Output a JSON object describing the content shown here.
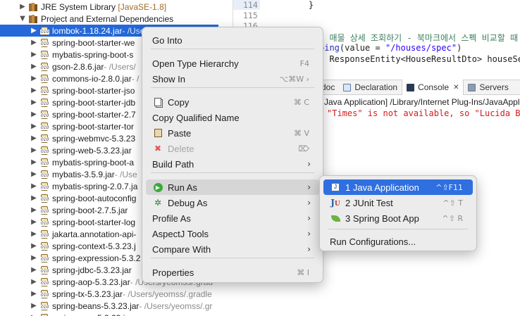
{
  "explorer": {
    "rows": [
      {
        "label": "JRE System Library",
        "path": "",
        "tag": "[JavaSE-1.8]"
      },
      {
        "label": "Project and External Dependencies",
        "path": "",
        "tag": ""
      },
      {
        "label": "lombok-1.18.24.jar",
        "path": " - /Users/yeomss/.gradle",
        "tag": ""
      },
      {
        "label": "spring-boot-starter-we",
        "path": "",
        "tag": ""
      },
      {
        "label": "mybatis-spring-boot-s",
        "path": "",
        "tag": ""
      },
      {
        "label": "gson-2.8.6.jar",
        "path": " - /Users/",
        "tag": ""
      },
      {
        "label": "commons-io-2.8.0.jar",
        "path": " - /",
        "tag": ""
      },
      {
        "label": "spring-boot-starter-jso",
        "path": "",
        "tag": ""
      },
      {
        "label": "spring-boot-starter-jdb",
        "path": "",
        "tag": ""
      },
      {
        "label": "spring-boot-starter-2.7",
        "path": "",
        "tag": ""
      },
      {
        "label": "spring-boot-starter-tor",
        "path": "",
        "tag": ""
      },
      {
        "label": "spring-webmvc-5.3.23",
        "path": "",
        "tag": ""
      },
      {
        "label": "spring-web-5.3.23.jar",
        "path": "",
        "tag": ""
      },
      {
        "label": "mybatis-spring-boot-a",
        "path": "",
        "tag": ""
      },
      {
        "label": "mybatis-3.5.9.jar",
        "path": " - /Use",
        "tag": ""
      },
      {
        "label": "mybatis-spring-2.0.7.ja",
        "path": "",
        "tag": ""
      },
      {
        "label": "spring-boot-autoconfig",
        "path": "",
        "tag": ""
      },
      {
        "label": "spring-boot-2.7.5.jar",
        "path": "",
        "tag": ""
      },
      {
        "label": "spring-boot-starter-log",
        "path": "",
        "tag": ""
      },
      {
        "label": "jakarta.annotation-api-",
        "path": "",
        "tag": ""
      },
      {
        "label": "spring-context-5.3.23.j",
        "path": "",
        "tag": ""
      },
      {
        "label": "spring-expression-5.3.2",
        "path": "",
        "tag": ""
      },
      {
        "label": "spring-jdbc-5.3.23.jar",
        "path": "",
        "tag": ""
      },
      {
        "label": "spring-aop-5.3.23.jar",
        "path": " - /Users/yeomss/.grad",
        "tag": ""
      },
      {
        "label": "spring-tx-5.3.23.jar",
        "path": " - /Users/yeomss/.gradle",
        "tag": ""
      },
      {
        "label": "spring-beans-5.3.23.jar",
        "path": " - /Users/yeomss/.gr",
        "tag": ""
      },
      {
        "label": "spring-core-5.3.23.jar",
        "path": "",
        "tag": ""
      }
    ]
  },
  "editor": {
    "line_numbers": [
      "114",
      "115",
      "116"
    ],
    "lines": [
      {
        "text": "    }",
        "cls": ""
      },
      {
        "text": "",
        "cls": ""
      },
      {
        "text": "",
        "cls": ""
      },
      {
        "text": "/ 매물 상세 조회하기 - 북마크에서 스펙 비교할 때 쓰",
        "cls": "cmt"
      },
      {
        "text": "ping(value = \"/houses/spec\")",
        "cls": ""
      },
      {
        "text": "  ResponseEntity<HouseResultDto> houseSe",
        "cls": ""
      }
    ]
  },
  "console_view": {
    "tabs": [
      {
        "label": "doc",
        "icon": "javadoc-icon",
        "active": false,
        "closable": false
      },
      {
        "label": "Declaration",
        "icon": "declaration-icon",
        "active": false,
        "closable": false
      },
      {
        "label": "Console",
        "icon": "console-icon",
        "active": true,
        "closable": true
      },
      {
        "label": "Servers",
        "icon": "servers-icon",
        "active": false,
        "closable": false
      }
    ],
    "header": "Java Application] /Library/Internet Plug-Ins/JavaApple",
    "error": "\"Times\" is not available, so \"Lucida B"
  },
  "context_menu": {
    "items": [
      {
        "label": "Go Into",
        "shortcut": "",
        "submenu": false,
        "icon": "",
        "disabled": false,
        "state": ""
      },
      {
        "label": "Open Type Hierarchy",
        "shortcut": "F4",
        "submenu": false,
        "icon": "",
        "disabled": false,
        "state": ""
      },
      {
        "label": "Show In",
        "shortcut": "⌥⌘W ›",
        "submenu": false,
        "icon": "",
        "disabled": false,
        "state": ""
      },
      {
        "label": "Copy",
        "shortcut": "⌘ C",
        "submenu": false,
        "icon": "copy-icon",
        "disabled": false,
        "state": ""
      },
      {
        "label": "Copy Qualified Name",
        "shortcut": "",
        "submenu": false,
        "icon": "",
        "disabled": false,
        "state": ""
      },
      {
        "label": "Paste",
        "shortcut": "⌘ V",
        "submenu": false,
        "icon": "paste-icon",
        "disabled": false,
        "state": ""
      },
      {
        "label": "Delete",
        "shortcut": "⌦",
        "submenu": false,
        "icon": "delete-icon",
        "disabled": true,
        "state": ""
      },
      {
        "label": "Build Path",
        "shortcut": "",
        "submenu": true,
        "icon": "",
        "disabled": false,
        "state": ""
      },
      {
        "label": "Run As",
        "shortcut": "",
        "submenu": true,
        "icon": "run-icon",
        "disabled": false,
        "state": "hover"
      },
      {
        "label": "Debug As",
        "shortcut": "",
        "submenu": true,
        "icon": "debug-icon",
        "disabled": false,
        "state": ""
      },
      {
        "label": "Profile As",
        "shortcut": "",
        "submenu": true,
        "icon": "",
        "disabled": false,
        "state": ""
      },
      {
        "label": "AspectJ Tools",
        "shortcut": "",
        "submenu": true,
        "icon": "",
        "disabled": false,
        "state": ""
      },
      {
        "label": "Compare With",
        "shortcut": "",
        "submenu": true,
        "icon": "",
        "disabled": false,
        "state": ""
      },
      {
        "label": "Properties",
        "shortcut": "⌘ I",
        "submenu": false,
        "icon": "",
        "disabled": false,
        "state": ""
      }
    ]
  },
  "run_as_submenu": {
    "items": [
      {
        "label": "1 Java Application",
        "shortcut": "^⇧F11",
        "icon": "java-app-icon",
        "state": "active"
      },
      {
        "label": "2 JUnit Test",
        "shortcut": "^⇧ T",
        "icon": "junit-icon",
        "state": ""
      },
      {
        "label": "3 Spring Boot App",
        "shortcut": "^⇧ R",
        "icon": "spring-boot-icon",
        "state": ""
      },
      {
        "label": "Run Configurations...",
        "shortcut": "",
        "icon": "",
        "state": ""
      }
    ]
  },
  "colors": {
    "selection": "#2468d9",
    "menu_active": "#2f6fe0",
    "console_error": "#d41c1c"
  }
}
